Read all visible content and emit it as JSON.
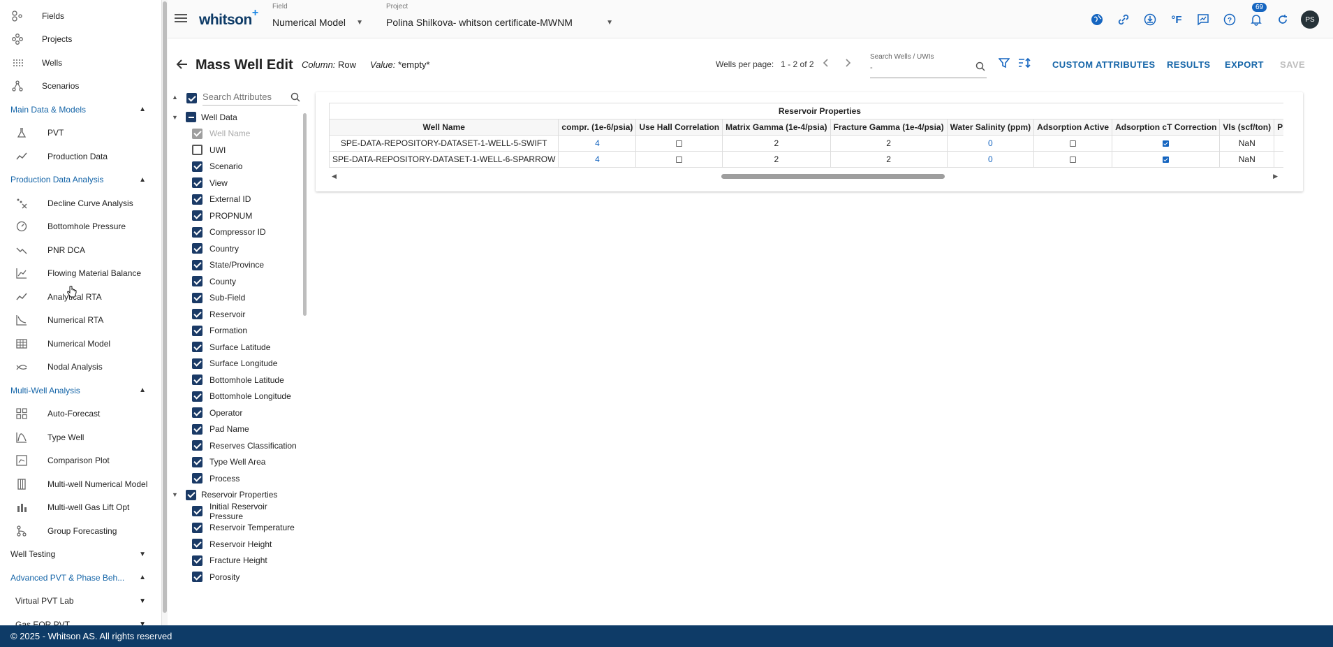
{
  "sidebar": {
    "top_items": [
      {
        "label": "Fields",
        "icon": "fields-icon"
      },
      {
        "label": "Projects",
        "icon": "projects-icon"
      },
      {
        "label": "Wells",
        "icon": "wells-icon"
      },
      {
        "label": "Scenarios",
        "icon": "scenarios-icon"
      }
    ],
    "sections": {
      "main_data": {
        "title": "Main Data & Models",
        "items": [
          "PVT",
          "Production Data"
        ]
      },
      "pda": {
        "title": "Production Data Analysis",
        "items": [
          "Decline Curve Analysis",
          "Bottomhole Pressure",
          "PNR DCA",
          "Flowing Material Balance",
          "Analytical RTA",
          "Numerical RTA",
          "Numerical Model",
          "Nodal Analysis"
        ]
      },
      "mwa": {
        "title": "Multi-Well Analysis",
        "items": [
          "Auto-Forecast",
          "Type Well",
          "Comparison Plot",
          "Multi-well Numerical Model",
          "Multi-well Gas Lift Opt",
          "Group Forecasting"
        ]
      },
      "well_testing": {
        "title": "Well Testing"
      },
      "adv_pvt": {
        "title": "Advanced PVT & Phase Beh...",
        "subs": [
          "Virtual PVT Lab",
          "Gas EOR PVT"
        ]
      }
    }
  },
  "topbar": {
    "logo": "whitson",
    "logo_plus": "+",
    "field_label": "Field",
    "field_value": "Numerical Model",
    "project_label": "Project",
    "project_value": "Polina Shilkova- whitson certificate-MWNM",
    "notif_count": "69",
    "temp_unit": "°F",
    "avatar": "PS"
  },
  "header": {
    "title": "Mass Well Edit",
    "column_label": "Column:",
    "column_value": "Row",
    "value_label": "Value:",
    "value_value": "*empty*",
    "wells_per_page_label": "Wells per page:",
    "pagination": "1 - 2 of 2",
    "search_label": "Search Wells / UWIs",
    "search_value": "-",
    "custom_attributes": "CUSTOM ATTRIBUTES",
    "results": "RESULTS",
    "export": "EXPORT",
    "save": "SAVE"
  },
  "tree": {
    "search_placeholder": "Search Attributes",
    "well_data": {
      "label": "Well Data",
      "items": [
        {
          "label": "Well Name",
          "state": "dis"
        },
        {
          "label": "UWI",
          "state": "off"
        },
        {
          "label": "Scenario",
          "state": "on"
        },
        {
          "label": "View",
          "state": "on"
        },
        {
          "label": "External ID",
          "state": "on"
        },
        {
          "label": "PROPNUM",
          "state": "on"
        },
        {
          "label": "Compressor ID",
          "state": "on"
        },
        {
          "label": "Country",
          "state": "on"
        },
        {
          "label": "State/Province",
          "state": "on"
        },
        {
          "label": "County",
          "state": "on"
        },
        {
          "label": "Sub-Field",
          "state": "on"
        },
        {
          "label": "Reservoir",
          "state": "on"
        },
        {
          "label": "Formation",
          "state": "on"
        },
        {
          "label": "Surface Latitude",
          "state": "on"
        },
        {
          "label": "Surface Longitude",
          "state": "on"
        },
        {
          "label": "Bottomhole Latitude",
          "state": "on"
        },
        {
          "label": "Bottomhole Longitude",
          "state": "on"
        },
        {
          "label": "Operator",
          "state": "on"
        },
        {
          "label": "Pad Name",
          "state": "on"
        },
        {
          "label": "Reserves Classification",
          "state": "on"
        },
        {
          "label": "Type Well Area",
          "state": "on"
        },
        {
          "label": "Process",
          "state": "on"
        }
      ]
    },
    "reservoir": {
      "label": "Reservoir Properties",
      "items": [
        {
          "label": "Initial Reservoir Pressure",
          "state": "on"
        },
        {
          "label": "Reservoir Temperature",
          "state": "on"
        },
        {
          "label": "Reservoir Height",
          "state": "on"
        },
        {
          "label": "Fracture Height",
          "state": "on"
        },
        {
          "label": "Porosity",
          "state": "on"
        }
      ]
    }
  },
  "table": {
    "group_header": "Reservoir Properties",
    "columns": [
      "Well Name",
      "compr. (1e-6/psia)",
      "Use Hall Correlation",
      "Matrix Gamma (1e-4/psia)",
      "Fracture Gamma (1e-4/psia)",
      "Water Salinity (ppm)",
      "Adsorption Active",
      "Adsorption cT Correction",
      "Vls (scf/ton)",
      "Pls (psi"
    ],
    "rows": [
      {
        "well": "SPE-DATA-REPOSITORY-DATASET-1-WELL-5-SWIFT",
        "compr": "4",
        "hall": false,
        "mgamma": "2",
        "fgamma": "2",
        "salinity": "0",
        "ads": false,
        "adsct": true,
        "vls": "NaN",
        "pls": ""
      },
      {
        "well": "SPE-DATA-REPOSITORY-DATASET-1-WELL-6-SPARROW",
        "compr": "4",
        "hall": false,
        "mgamma": "2",
        "fgamma": "2",
        "salinity": "0",
        "ads": false,
        "adsct": true,
        "vls": "NaN",
        "pls": ""
      }
    ]
  },
  "footer": "© 2025 - Whitson AS. All rights reserved",
  "colors": {
    "brand": "#0e3b67",
    "accent": "#1565c0"
  }
}
